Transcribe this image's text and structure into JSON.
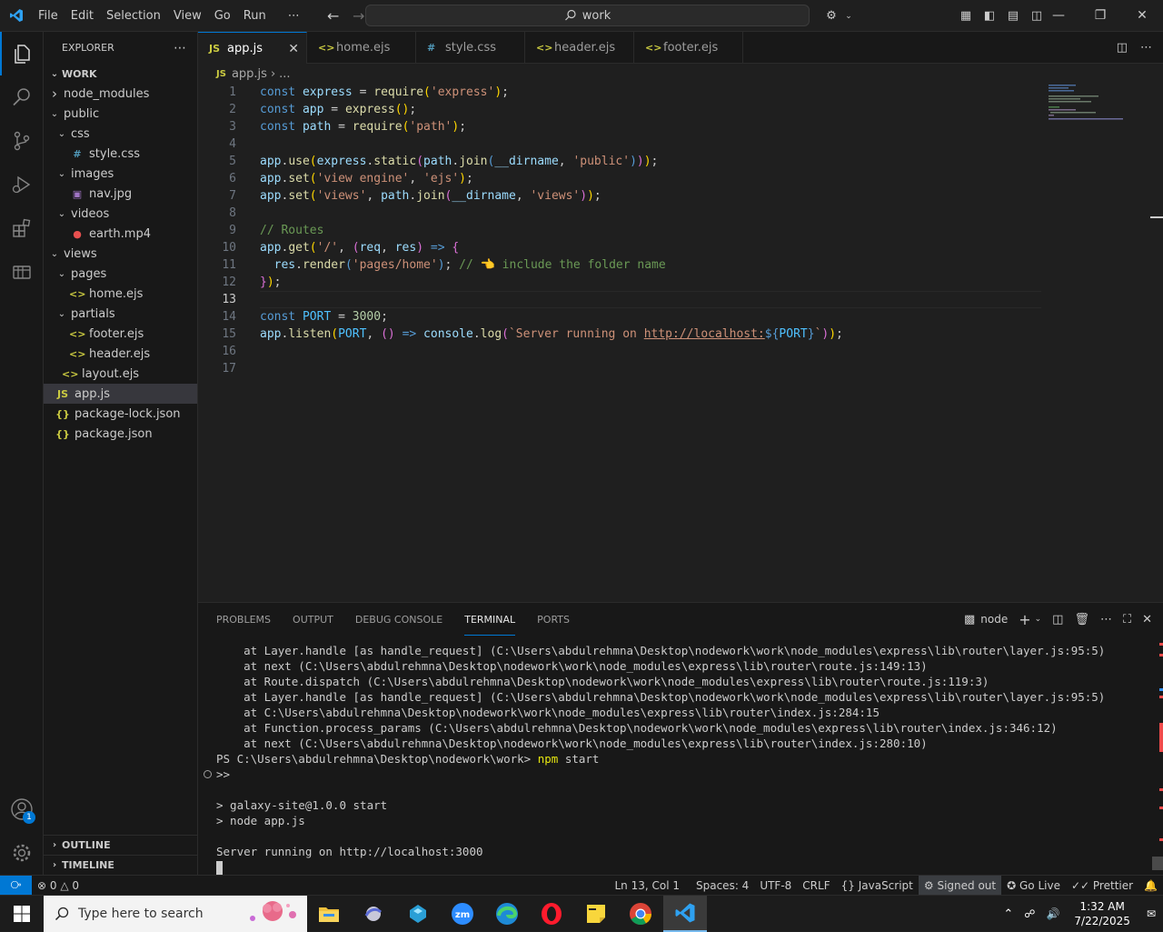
{
  "titlebar": {
    "menu": [
      "File",
      "Edit",
      "Selection",
      "View",
      "Go",
      "Run",
      "⋯"
    ],
    "search_text": "work"
  },
  "explorer": {
    "title": "EXPLORER",
    "root": "WORK",
    "items": [
      {
        "label": "node_modules",
        "depth": 1,
        "type": "folder-closed"
      },
      {
        "label": "public",
        "depth": 1,
        "type": "folder-open"
      },
      {
        "label": "css",
        "depth": 2,
        "type": "folder-open"
      },
      {
        "label": "style.css",
        "depth": 3,
        "type": "css"
      },
      {
        "label": "images",
        "depth": 2,
        "type": "folder-open"
      },
      {
        "label": "nav.jpg",
        "depth": 3,
        "type": "image"
      },
      {
        "label": "videos",
        "depth": 2,
        "type": "folder-open"
      },
      {
        "label": "earth.mp4",
        "depth": 3,
        "type": "video"
      },
      {
        "label": "views",
        "depth": 1,
        "type": "folder-open"
      },
      {
        "label": "pages",
        "depth": 2,
        "type": "folder-open"
      },
      {
        "label": "home.ejs",
        "depth": 3,
        "type": "ejs"
      },
      {
        "label": "partials",
        "depth": 2,
        "type": "folder-open"
      },
      {
        "label": "footer.ejs",
        "depth": 3,
        "type": "ejs"
      },
      {
        "label": "header.ejs",
        "depth": 3,
        "type": "ejs"
      },
      {
        "label": "layout.ejs",
        "depth": 2,
        "type": "ejs"
      },
      {
        "label": "app.js",
        "depth": 1,
        "type": "js",
        "selected": true
      },
      {
        "label": "package-lock.json",
        "depth": 1,
        "type": "json"
      },
      {
        "label": "package.json",
        "depth": 1,
        "type": "json"
      }
    ],
    "outline": "OUTLINE",
    "timeline": "TIMELINE"
  },
  "tabs": [
    {
      "label": "app.js",
      "icon": "JS",
      "active": true
    },
    {
      "label": "home.ejs",
      "icon": "<>"
    },
    {
      "label": "style.css",
      "icon": "#"
    },
    {
      "label": "header.ejs",
      "icon": "<>"
    },
    {
      "label": "footer.ejs",
      "icon": "<>"
    }
  ],
  "breadcrumb": {
    "icon": "JS",
    "file": "app.js",
    "rest": "..."
  },
  "code": {
    "current_line": 13,
    "lines": [
      {
        "n": "1",
        "tokens": [
          [
            "k",
            "const "
          ],
          [
            "v",
            "express"
          ],
          [
            "code",
            " = "
          ],
          [
            "f",
            "require"
          ],
          [
            "b",
            "("
          ],
          [
            "s",
            "'express'"
          ],
          [
            "b",
            ")"
          ],
          [
            "code",
            ";"
          ]
        ]
      },
      {
        "n": "2",
        "tokens": [
          [
            "k",
            "const "
          ],
          [
            "v",
            "app"
          ],
          [
            "code",
            " = "
          ],
          [
            "f",
            "express"
          ],
          [
            "b",
            "()"
          ],
          [
            "code",
            ";"
          ]
        ]
      },
      {
        "n": "3",
        "tokens": [
          [
            "k",
            "const "
          ],
          [
            "v",
            "path"
          ],
          [
            "code",
            " = "
          ],
          [
            "f",
            "require"
          ],
          [
            "b",
            "("
          ],
          [
            "s",
            "'path'"
          ],
          [
            "b",
            ")"
          ],
          [
            "code",
            ";"
          ]
        ]
      },
      {
        "n": "4",
        "tokens": []
      },
      {
        "n": "5",
        "tokens": [
          [
            "v",
            "app"
          ],
          [
            "code",
            "."
          ],
          [
            "f",
            "use"
          ],
          [
            "b",
            "("
          ],
          [
            "v",
            "express"
          ],
          [
            "code",
            "."
          ],
          [
            "f",
            "static"
          ],
          [
            "p",
            "("
          ],
          [
            "v",
            "path"
          ],
          [
            "code",
            "."
          ],
          [
            "f",
            "join"
          ],
          [
            "k",
            "("
          ],
          [
            "v",
            "__dirname"
          ],
          [
            "code",
            ", "
          ],
          [
            "s",
            "'public'"
          ],
          [
            "k",
            ")"
          ],
          [
            "p",
            ")"
          ],
          [
            "b",
            ")"
          ],
          [
            "code",
            ";"
          ]
        ]
      },
      {
        "n": "6",
        "tokens": [
          [
            "v",
            "app"
          ],
          [
            "code",
            "."
          ],
          [
            "f",
            "set"
          ],
          [
            "b",
            "("
          ],
          [
            "s",
            "'view engine'"
          ],
          [
            "code",
            ", "
          ],
          [
            "s",
            "'ejs'"
          ],
          [
            "b",
            ")"
          ],
          [
            "code",
            ";"
          ]
        ]
      },
      {
        "n": "7",
        "tokens": [
          [
            "v",
            "app"
          ],
          [
            "code",
            "."
          ],
          [
            "f",
            "set"
          ],
          [
            "b",
            "("
          ],
          [
            "s",
            "'views'"
          ],
          [
            "code",
            ", "
          ],
          [
            "v",
            "path"
          ],
          [
            "code",
            "."
          ],
          [
            "f",
            "join"
          ],
          [
            "p",
            "("
          ],
          [
            "v",
            "__dirname"
          ],
          [
            "code",
            ", "
          ],
          [
            "s",
            "'views'"
          ],
          [
            "p",
            ")"
          ],
          [
            "b",
            ")"
          ],
          [
            "code",
            ";"
          ]
        ]
      },
      {
        "n": "8",
        "tokens": []
      },
      {
        "n": "9",
        "tokens": [
          [
            "c",
            "// Routes"
          ]
        ]
      },
      {
        "n": "10",
        "tokens": [
          [
            "v",
            "app"
          ],
          [
            "code",
            "."
          ],
          [
            "f",
            "get"
          ],
          [
            "b",
            "("
          ],
          [
            "s",
            "'/'"
          ],
          [
            "code",
            ", "
          ],
          [
            "p",
            "("
          ],
          [
            "v",
            "req"
          ],
          [
            "code",
            ", "
          ],
          [
            "v",
            "res"
          ],
          [
            "p",
            ")"
          ],
          [
            "code",
            " "
          ],
          [
            "k",
            "=>"
          ],
          [
            "code",
            " "
          ],
          [
            "p",
            "{"
          ]
        ]
      },
      {
        "n": "11",
        "tokens": [
          [
            "code",
            "  "
          ],
          [
            "v",
            "res"
          ],
          [
            "code",
            "."
          ],
          [
            "f",
            "render"
          ],
          [
            "k",
            "("
          ],
          [
            "s",
            "'pages/home'"
          ],
          [
            "k",
            ")"
          ],
          [
            "code",
            "; "
          ],
          [
            "c",
            "// 👈 include the folder name"
          ]
        ]
      },
      {
        "n": "12",
        "tokens": [
          [
            "p",
            "}"
          ],
          [
            "b",
            ")"
          ],
          [
            "code",
            ";"
          ]
        ]
      },
      {
        "n": "13",
        "tokens": []
      },
      {
        "n": "14",
        "tokens": [
          [
            "k",
            "const "
          ],
          [
            "cn",
            "PORT"
          ],
          [
            "code",
            " = "
          ],
          [
            "n",
            "3000"
          ],
          [
            "code",
            ";"
          ]
        ]
      },
      {
        "n": "15",
        "tokens": [
          [
            "v",
            "app"
          ],
          [
            "code",
            "."
          ],
          [
            "f",
            "listen"
          ],
          [
            "b",
            "("
          ],
          [
            "cn",
            "PORT"
          ],
          [
            "code",
            ", "
          ],
          [
            "p",
            "()"
          ],
          [
            "code",
            " "
          ],
          [
            "k",
            "=>"
          ],
          [
            "code",
            " "
          ],
          [
            "v",
            "console"
          ],
          [
            "code",
            "."
          ],
          [
            "f",
            "log"
          ],
          [
            "p",
            "("
          ],
          [
            "s",
            "`Server running on "
          ],
          [
            "u",
            "http://localhost:"
          ],
          [
            "k",
            "${"
          ],
          [
            "cn",
            "PORT"
          ],
          [
            "k",
            "}"
          ],
          [
            "s",
            "`"
          ],
          [
            "p",
            ")"
          ],
          [
            "b",
            ")"
          ],
          [
            "code",
            ";"
          ]
        ]
      },
      {
        "n": "16",
        "tokens": []
      },
      {
        "n": "17",
        "tokens": []
      }
    ]
  },
  "panel": {
    "tabs": [
      "PROBLEMS",
      "OUTPUT",
      "DEBUG CONSOLE",
      "TERMINAL",
      "PORTS"
    ],
    "active_tab": "TERMINAL",
    "terminal_name": "node",
    "lines": [
      "    at Layer.handle [as handle_request] (C:\\Users\\abdulrehmna\\Desktop\\nodework\\work\\node_modules\\express\\lib\\router\\layer.js:95:5)",
      "    at next (C:\\Users\\abdulrehmna\\Desktop\\nodework\\work\\node_modules\\express\\lib\\router\\route.js:149:13)",
      "    at Route.dispatch (C:\\Users\\abdulrehmna\\Desktop\\nodework\\work\\node_modules\\express\\lib\\router\\route.js:119:3)",
      "    at Layer.handle [as handle_request] (C:\\Users\\abdulrehmna\\Desktop\\nodework\\work\\node_modules\\express\\lib\\router\\layer.js:95:5)",
      "    at C:\\Users\\abdulrehmna\\Desktop\\nodework\\work\\node_modules\\express\\lib\\router\\index.js:284:15",
      "    at Function.process_params (C:\\Users\\abdulrehmna\\Desktop\\nodework\\work\\node_modules\\express\\lib\\router\\index.js:346:12)",
      "    at next (C:\\Users\\abdulrehmna\\Desktop\\nodework\\work\\node_modules\\express\\lib\\router\\index.js:280:10)",
      "PS C:\\Users\\abdulrehmna\\Desktop\\nodework\\work> npm start",
      ">>",
      "",
      "> galaxy-site@1.0.0 start",
      "> node app.js",
      "",
      "Server running on http://localhost:3000"
    ]
  },
  "status": {
    "errors": "0",
    "warnings": "0",
    "position": "Ln 13, Col 1",
    "spaces": "Spaces: 4",
    "encoding": "UTF-8",
    "eol": "CRLF",
    "language": "JavaScript",
    "account": "Signed out",
    "golive": "Go Live",
    "prettier": "Prettier"
  },
  "taskbar": {
    "search_placeholder": "Type here to search",
    "time": "1:32 AM",
    "date": "7/22/2025"
  },
  "colors": {
    "accent": "#0078d4",
    "bg": "#1f1f1f",
    "sidebar": "#181818"
  }
}
